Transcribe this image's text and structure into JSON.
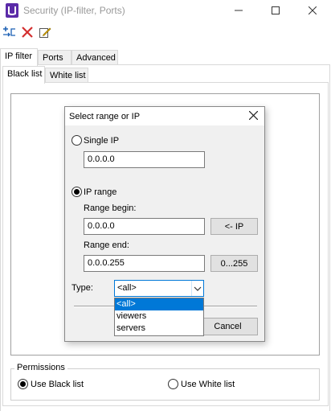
{
  "window": {
    "title": "Security (IP-filter, Ports)",
    "controls": {
      "minimize": "minimize-icon",
      "maximize": "maximize-icon",
      "close": "close-icon"
    }
  },
  "toolbar": {
    "buttons": [
      "add-rule-icon",
      "delete-icon",
      "edit-icon"
    ]
  },
  "tabs": {
    "main": [
      "IP filter",
      "Ports",
      "Advanced"
    ],
    "active_main": "IP filter",
    "sub": [
      "Black list",
      "White list"
    ],
    "active_sub": "Black list"
  },
  "dialog": {
    "title": "Select range or IP",
    "single_ip_label": "Single IP",
    "single_ip_value": "0.0.0.0",
    "ip_range_label": "IP range",
    "range_begin_label": "Range begin:",
    "range_begin_value": "0.0.0.0",
    "ip_button": "<- IP",
    "range_end_label": "Range end:",
    "range_end_value": "0.0.0.255",
    "range_button": "0...255",
    "type_label": "Type:",
    "type_value": "<all>",
    "type_options": [
      "<all>",
      "viewers",
      "servers"
    ],
    "cancel_button": "Cancel",
    "selected_mode": "IP range"
  },
  "permissions": {
    "legend": "Permissions",
    "use_black": "Use Black list",
    "use_white": "Use White list",
    "selected": "Use Black list"
  },
  "colors": {
    "accent": "#0078d7",
    "delete_red": "#d32f2f",
    "tool_blue": "#1a5fb4"
  }
}
